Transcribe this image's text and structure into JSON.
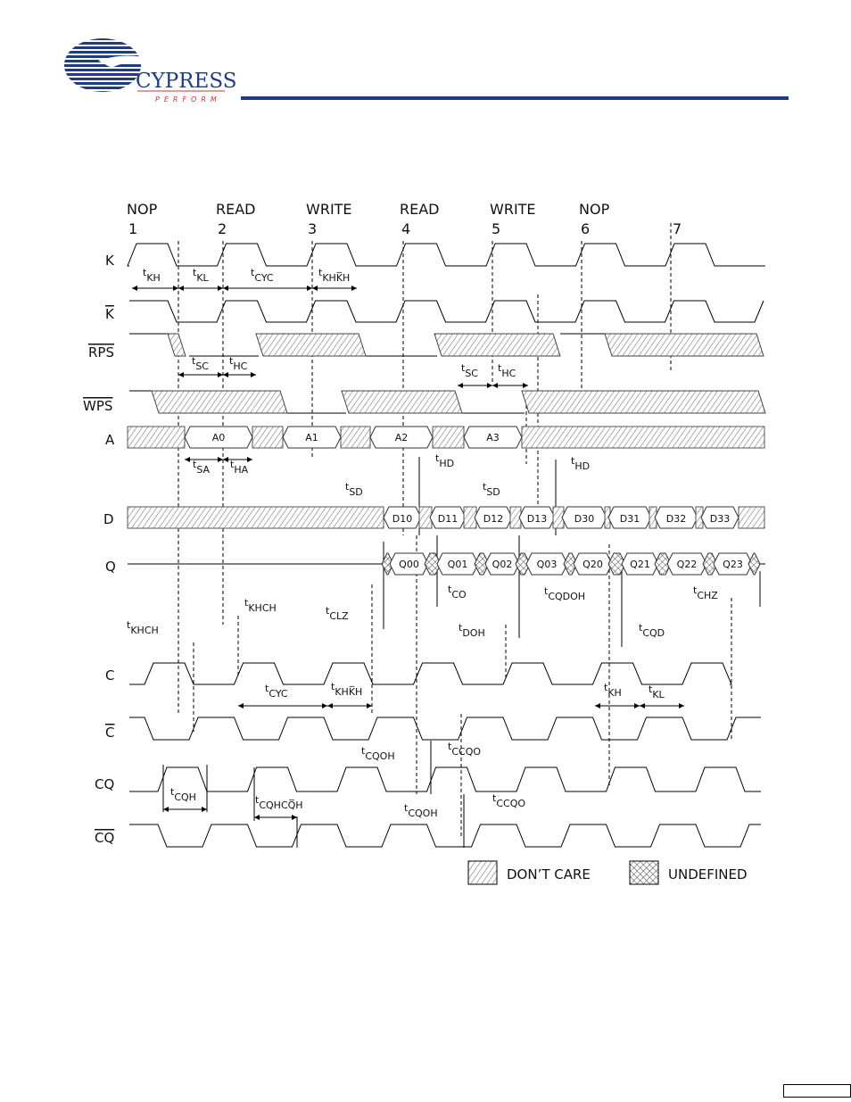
{
  "header": {
    "logo_text": "CYPRESS",
    "logo_tagline": "PERFORM",
    "rule_color": "#1f3b82"
  },
  "cycles": [
    {
      "command": "NOP",
      "number": "1"
    },
    {
      "command": "READ",
      "number": "2"
    },
    {
      "command": "WRITE",
      "number": "3"
    },
    {
      "command": "READ",
      "number": "4"
    },
    {
      "command": "WRITE",
      "number": "5"
    },
    {
      "command": "NOP",
      "number": "6"
    },
    {
      "command": "",
      "number": "7"
    }
  ],
  "signals": [
    {
      "name": "K",
      "overline": false
    },
    {
      "name": "K",
      "overline": true
    },
    {
      "name": "RPS",
      "overline": true
    },
    {
      "name": "WPS",
      "overline": true
    },
    {
      "name": "A",
      "overline": false
    },
    {
      "name": "D",
      "overline": false
    },
    {
      "name": "Q",
      "overline": false
    },
    {
      "name": "C",
      "overline": false
    },
    {
      "name": "C",
      "overline": true
    },
    {
      "name": "CQ",
      "overline": false
    },
    {
      "name": "CQ",
      "overline": true
    }
  ],
  "address_values": [
    "A0",
    "A1",
    "A2",
    "A3"
  ],
  "data_in_values": [
    "D10",
    "D11",
    "D12",
    "D13",
    "D30",
    "D31",
    "D32",
    "D33"
  ],
  "data_out_values": [
    "Q00",
    "Q01",
    "Q02",
    "Q03",
    "Q20",
    "Q21",
    "Q22",
    "Q23"
  ],
  "timing_labels": [
    {
      "t": "t",
      "sub": "KH"
    },
    {
      "t": "t",
      "sub": "KL"
    },
    {
      "t": "t",
      "sub": "CYC"
    },
    {
      "t": "t",
      "sub": "KHK̅H"
    },
    {
      "t": "t",
      "sub": "SC"
    },
    {
      "t": "t",
      "sub": "HC"
    },
    {
      "t": "t",
      "sub": "SC"
    },
    {
      "t": "t",
      "sub": "HC"
    },
    {
      "t": "t",
      "sub": "SA"
    },
    {
      "t": "t",
      "sub": "HA"
    },
    {
      "t": "t",
      "sub": "HD"
    },
    {
      "t": "t",
      "sub": "HD"
    },
    {
      "t": "t",
      "sub": "SD"
    },
    {
      "t": "t",
      "sub": "SD"
    },
    {
      "t": "t",
      "sub": "CO"
    },
    {
      "t": "t",
      "sub": "CQDOH"
    },
    {
      "t": "t",
      "sub": "CHZ"
    },
    {
      "t": "t",
      "sub": "KHCH"
    },
    {
      "t": "t",
      "sub": "CLZ"
    },
    {
      "t": "t",
      "sub": "KHCH"
    },
    {
      "t": "t",
      "sub": "DOH"
    },
    {
      "t": "t",
      "sub": "CQD"
    },
    {
      "t": "t",
      "sub": "CYC"
    },
    {
      "t": "t",
      "sub": "KHK̅H"
    },
    {
      "t": "t",
      "sub": "KH"
    },
    {
      "t": "t",
      "sub": "KL"
    },
    {
      "t": "t",
      "sub": "CQOH"
    },
    {
      "t": "t",
      "sub": "CCQO"
    },
    {
      "t": "t",
      "sub": "CQH"
    },
    {
      "t": "t",
      "sub": "CQHCQ̅H"
    },
    {
      "t": "t",
      "sub": "CQOH"
    },
    {
      "t": "t",
      "sub": "CCQO"
    }
  ],
  "legend": {
    "dont_care": "DON’T CARE",
    "undefined": "UNDEFINED"
  }
}
